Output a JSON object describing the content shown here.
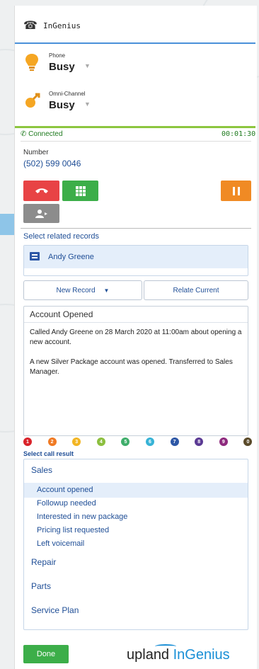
{
  "header": {
    "title": "InGenius"
  },
  "phone_status": {
    "label": "Phone",
    "value": "Busy"
  },
  "omni_status": {
    "label": "Omni-Channel",
    "value": "Busy"
  },
  "call": {
    "state": "Connected",
    "timer": "00:01:30",
    "number_label": "Number",
    "number": "(502) 599 0046"
  },
  "related": {
    "title": "Select related records",
    "records": [
      {
        "name": "Andy Greene"
      }
    ],
    "new_record": "New Record",
    "relate_current": "Relate Current"
  },
  "note": {
    "title": "Account Opened",
    "body": "Called Andy Greene on 28 March 2020 at 11:00am about opening a new account.\n\nA new Silver Package account was opened. Transferred to Sales Manager."
  },
  "dispositions": [
    "1",
    "2",
    "3",
    "4",
    "5",
    "6",
    "7",
    "8",
    "9",
    "0"
  ],
  "disposition_colors": [
    "#d9232a",
    "#f07a23",
    "#f2b523",
    "#8cbf3f",
    "#3fae6b",
    "#37b3d6",
    "#2d57a6",
    "#5b3a94",
    "#8e2a7e",
    "#5a4a2a"
  ],
  "call_result": {
    "title": "Select call result",
    "groups": [
      {
        "name": "Sales",
        "items": [
          "Account opened",
          "Followup needed",
          "Interested in new package",
          "Pricing list requested",
          "Left voicemail"
        ]
      },
      {
        "name": "Repair"
      },
      {
        "name": "Parts"
      },
      {
        "name": "Service Plan"
      }
    ],
    "selected": "Account opened"
  },
  "footer": {
    "done": "Done",
    "logo_a": "upland",
    "logo_b": "InGenius"
  }
}
